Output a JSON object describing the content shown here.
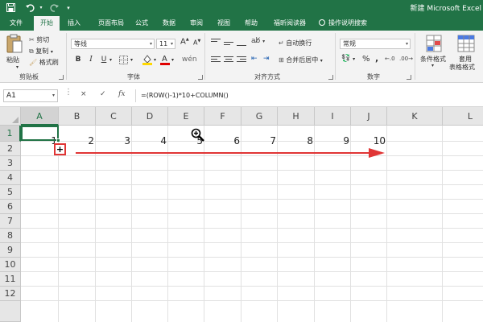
{
  "title_bar": {
    "title": "新建 Microsoft Excel",
    "save_icon": "save-icon",
    "undo_icon": "undo-icon",
    "redo_icon": "redo-icon"
  },
  "tabs": [
    {
      "label": "文件"
    },
    {
      "label": "开始",
      "active": true
    },
    {
      "label": "插入"
    },
    {
      "label": "页面布局"
    },
    {
      "label": "公式"
    },
    {
      "label": "数据"
    },
    {
      "label": "审阅"
    },
    {
      "label": "视图"
    },
    {
      "label": "帮助"
    },
    {
      "label": "福昕阅读器"
    },
    {
      "label": "操作说明搜索"
    }
  ],
  "ribbon": {
    "clipboard": {
      "paste": "粘贴",
      "cut": "剪切",
      "copy": "复制",
      "format_painter": "格式刷",
      "group_label": "剪贴板"
    },
    "font": {
      "font_name": "等线",
      "font_size": "11",
      "bold": "B",
      "italic": "I",
      "underline": "U",
      "group_label": "字体"
    },
    "alignment": {
      "wrap_text": "自动换行",
      "merge_center": "合并后居中",
      "group_label": "对齐方式"
    },
    "number": {
      "format": "常规",
      "percent": "%",
      "comma": ",",
      "group_label": "数字"
    },
    "styles": {
      "conditional_formatting": "条件格式",
      "table_format_line1": "套用",
      "table_format_line2": "表格格式"
    }
  },
  "formula_bar": {
    "name_box": "A1",
    "cancel": "×",
    "enter": "✓",
    "fx": "fx",
    "formula": "=(ROW()-1)*10+COLUMN()"
  },
  "sheet": {
    "columns": [
      "A",
      "B",
      "C",
      "D",
      "E",
      "F",
      "G",
      "H",
      "I",
      "J",
      "K",
      "L"
    ],
    "rows": [
      "1",
      "2",
      "3",
      "4",
      "5",
      "6",
      "7",
      "8",
      "9",
      "10",
      "11",
      "12"
    ],
    "row1_values": [
      "1",
      "2",
      "3",
      "4",
      "5",
      "6",
      "7",
      "8",
      "9",
      "10"
    ],
    "selected_cell": "A1",
    "accent": "#217346",
    "arrow_color": "#e03535"
  }
}
